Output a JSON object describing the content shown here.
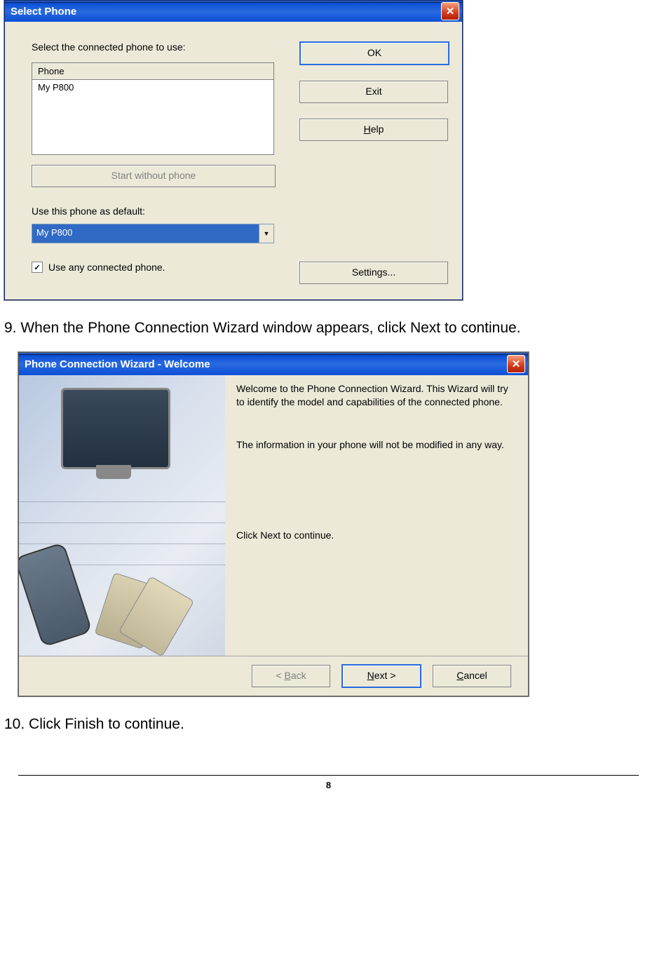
{
  "dialog1": {
    "title": "Select Phone",
    "label_select": "Select the connected phone to use:",
    "list_header": "Phone",
    "list_item": "My P800",
    "btn_ok": "OK",
    "btn_exit": "Exit",
    "btn_help": "Help",
    "btn_start_without": "Start without phone",
    "label_default": "Use this phone as default:",
    "combo_value": "My P800",
    "checkbox_label": "Use any connected phone.",
    "checkbox_checked": "✓",
    "btn_settings": "Settings..."
  },
  "instruction9": "9. When the Phone Connection Wizard window appears, click Next to continue.",
  "dialog2": {
    "title": "Phone Connection Wizard - Welcome",
    "para1": "Welcome to the Phone Connection Wizard. This Wizard will try to identify the model and capabilities of the connected phone.",
    "para2": "The information in your phone will not be modified in any way.",
    "para3": "Click Next to continue.",
    "btn_back": "< Back",
    "btn_next": "Next >",
    "btn_cancel": "Cancel"
  },
  "instruction10": "10. Click Finish to continue.",
  "page_number": "8"
}
